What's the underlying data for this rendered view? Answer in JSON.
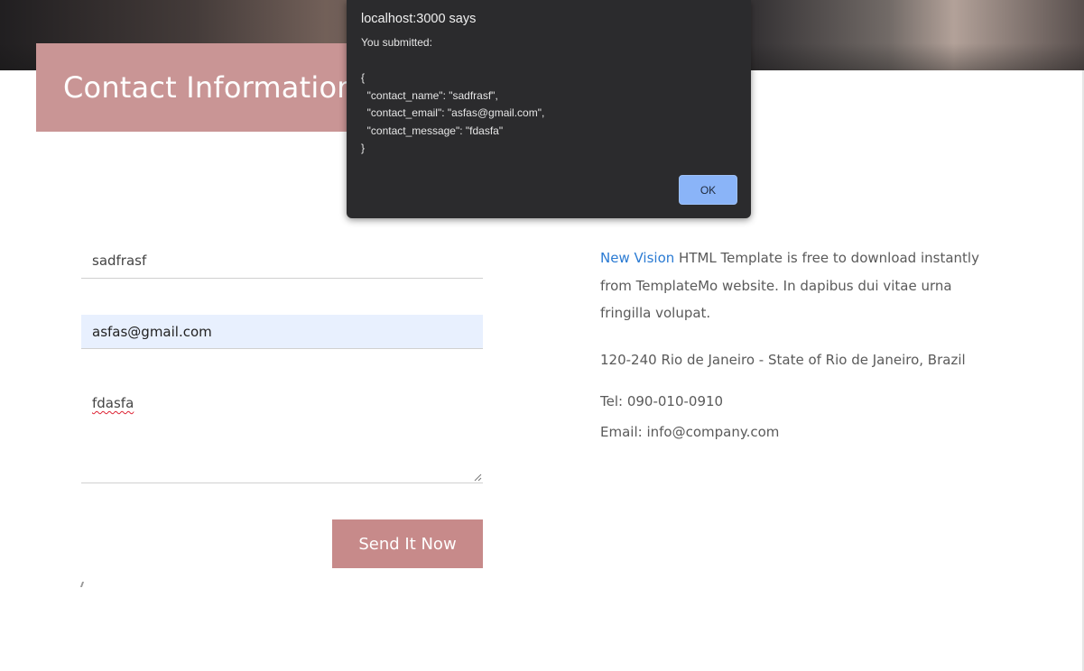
{
  "page": {
    "heading": "Contact Information"
  },
  "form": {
    "name_value": "sadfrasf",
    "email_value": "asfas@gmail.com",
    "message_value": "fdasfa",
    "submit_label": "Send It Now"
  },
  "info": {
    "link_text": "New Vision",
    "description_rest": " HTML Template is free to download instantly from TemplateMo website. In dapibus dui vitae urna fringilla volupat.",
    "address": "120-240 Rio de Janeiro - State of Rio de Janeiro, Brazil",
    "tel": "Tel: 090-010-0910",
    "email": "Email: info@company.com"
  },
  "dialog": {
    "title": "localhost:3000 says",
    "message": "You submitted:\n\n{\n  \"contact_name\": \"sadfrasf\",\n  \"contact_email\": \"asfas@gmail.com\",\n  \"contact_message\": \"fdasfa\"\n}",
    "ok_label": "OK"
  },
  "colors": {
    "accent": "#c99595",
    "button": "#c78a8a",
    "link": "#2b7bd3",
    "dialog_bg": "#2b2b2d",
    "ok_button": "#8ab4f8"
  }
}
